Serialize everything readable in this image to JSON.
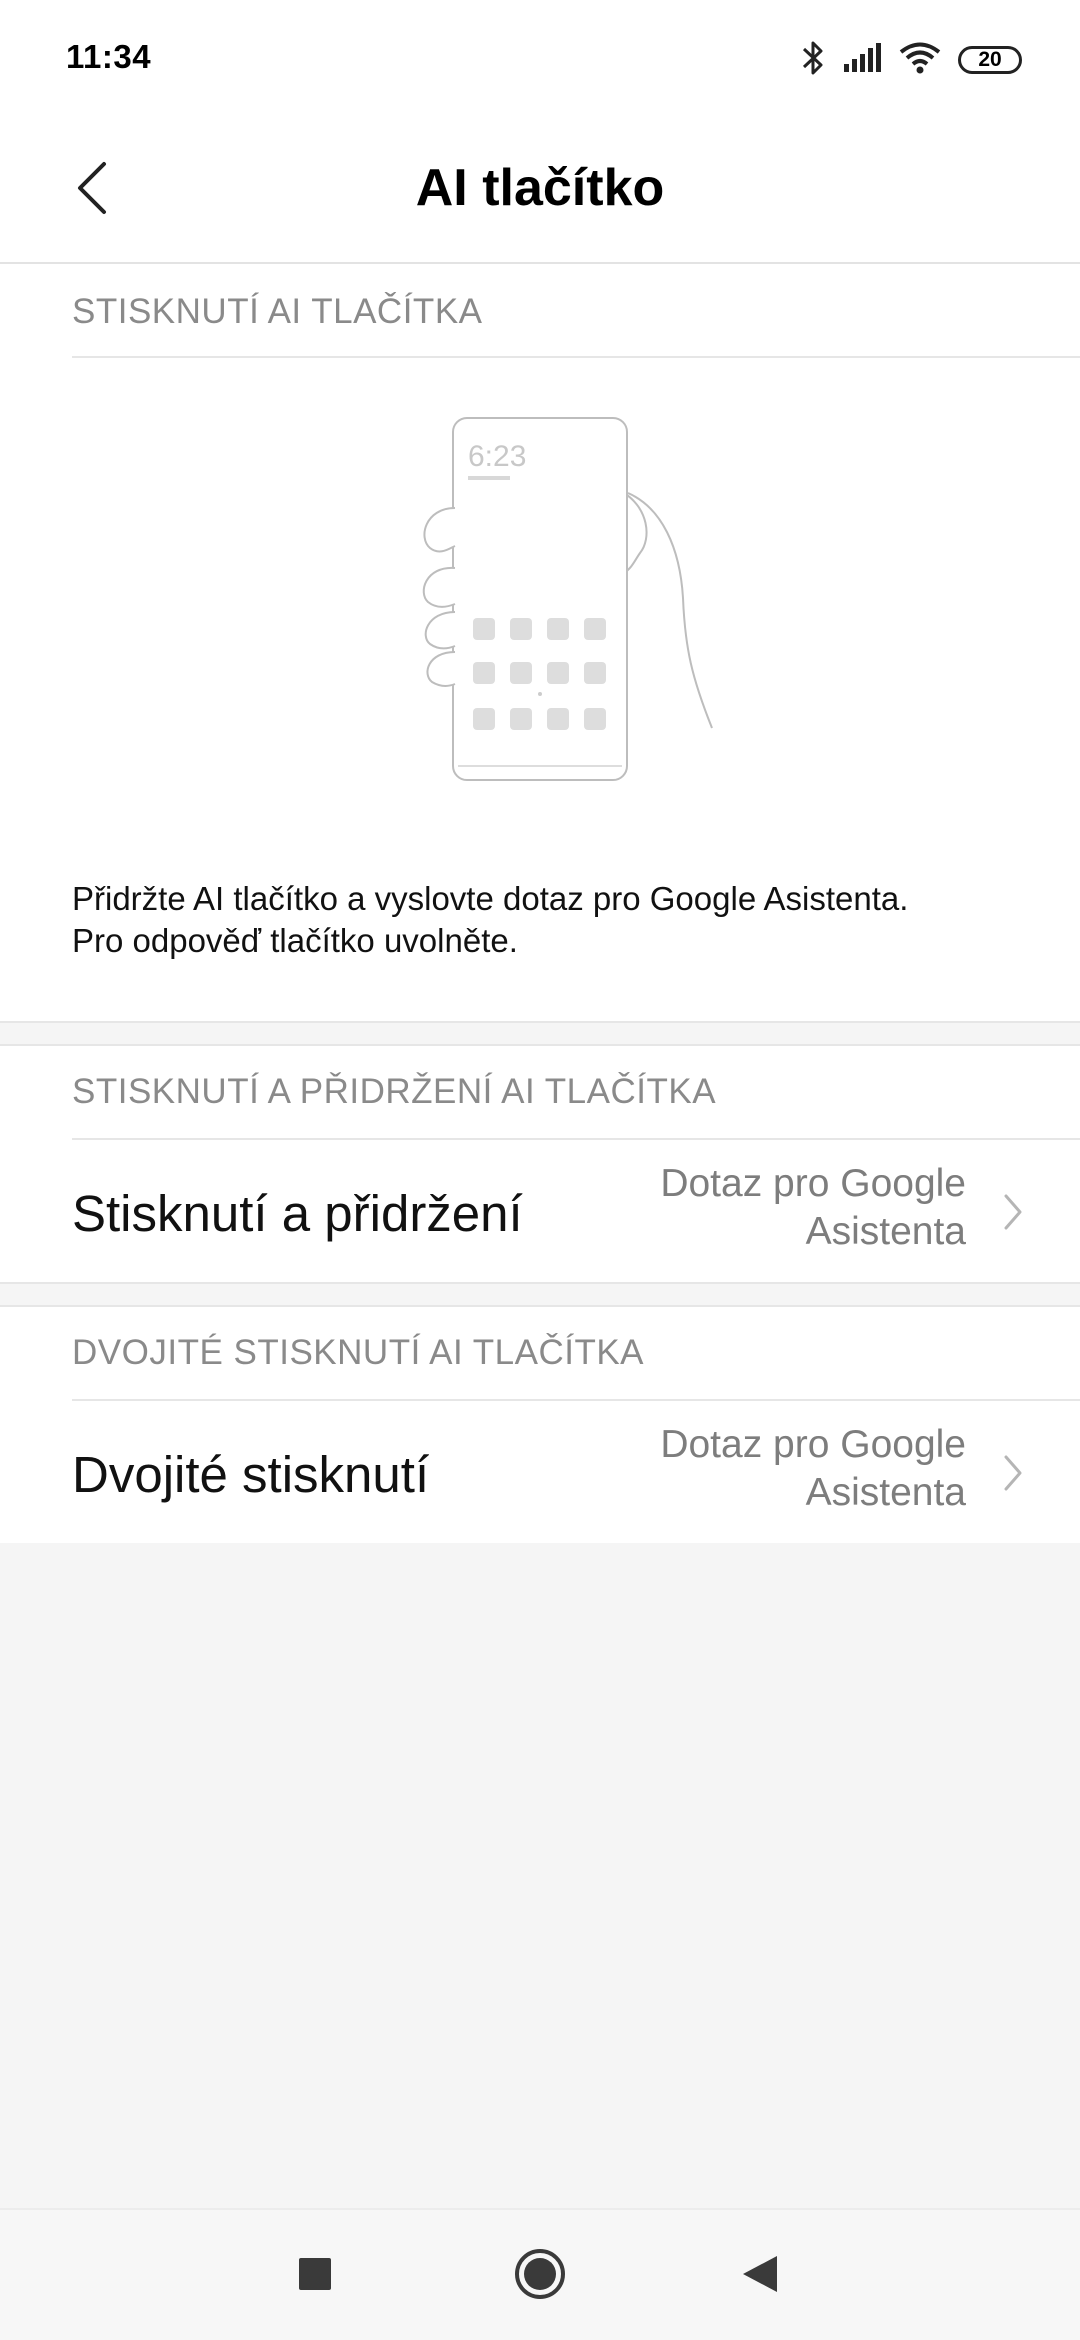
{
  "status_bar": {
    "time": "11:34",
    "battery": "20",
    "icons": [
      "bluetooth-icon",
      "signal-icon",
      "wifi-icon",
      "battery-icon"
    ]
  },
  "header": {
    "title": "AI tlačítko",
    "back_icon": "back-arrow-icon"
  },
  "section_press": {
    "header": "STISKNUTÍ AI TLAČÍTKA",
    "illustration_time": "6:23",
    "description_line1": "Přidržte AI tlačítko a vyslovte dotaz pro Google Asistenta.",
    "description_line2": "Pro odpověď tlačítko uvolněte."
  },
  "section_hold": {
    "header": "STISKNUTÍ A PŘIDRŽENÍ AI TLAČÍTKA",
    "row_label": "Stisknutí a přidržení",
    "row_value_line1": "Dotaz pro Google",
    "row_value_line2": "Asistenta"
  },
  "section_double": {
    "header": "DVOJITÉ STISKNUTÍ AI TLAČÍTKA",
    "row_label": "Dvojité stisknutí",
    "row_value_line1": "Dotaz pro Google",
    "row_value_line2": "Asistenta"
  },
  "nav_bar": {
    "icons": [
      "recents-icon",
      "home-icon",
      "back-icon"
    ]
  },
  "colors": {
    "background": "#f5f5f5",
    "card": "#ffffff",
    "secondary_text": "#8a8a8a",
    "divider": "#e6e6e6"
  }
}
